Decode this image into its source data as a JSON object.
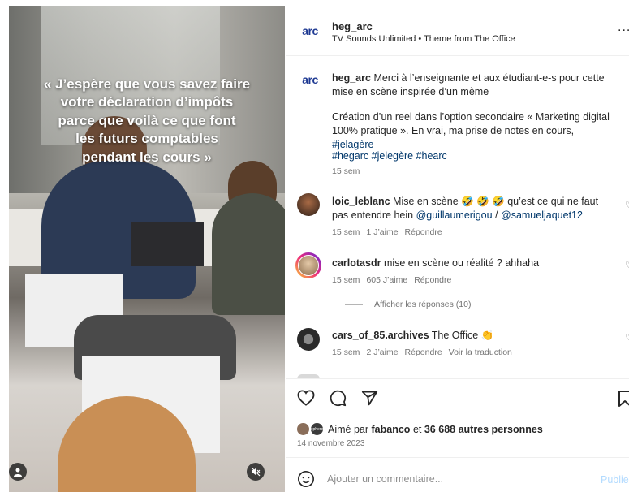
{
  "video": {
    "overlay_text": "« J’espère que vous savez faire\nvotre déclaration d’impôts\nparce que voilà ce que font\nles futurs comptables\npendant les cours »"
  },
  "header": {
    "logo_text": "arc",
    "username": "heg_arc",
    "audio": "TV Sounds Unlimited • Theme from The Office",
    "more_label": "..."
  },
  "caption": {
    "username": "heg_arc",
    "text1": "Merci à l’enseignante et aux étudiant-e-s pour cette mise en scène inspirée d’un mème",
    "text2": "Création d’un reel dans l’option secondaire « Marketing digital 100% pratique ». En vrai, ma prise de notes en cours,",
    "hashtag_inline": "#jelagère",
    "hashtags": "#hegarc #jelegère #hearc",
    "time": "15 sem"
  },
  "comments": [
    {
      "username": "loic_leblanc",
      "text": "Mise en scène 🤣 🤣 🤣 qu’est ce qui ne faut pas entendre hein",
      "mention1": "@guillaumerigou",
      "sep": " / ",
      "mention2": "@samueljaquet12",
      "time": "15 sem",
      "likes": "1 J’aime",
      "reply": "Répondre"
    },
    {
      "username": "carlotasdr",
      "text": "mise en scène ou réalité ? ahhaha",
      "time": "15 sem",
      "likes": "605 J’aime",
      "reply": "Répondre",
      "view_replies": "Afficher les réponses (10)"
    },
    {
      "username": "cars_of_85.archives",
      "text": "The Office 👏",
      "time": "15 sem",
      "likes": "2 J’aime",
      "reply": "Répondre",
      "translate": "Voir la traduction"
    }
  ],
  "likes": {
    "prefix": "Aimé par",
    "user": "fabanco",
    "and": "et",
    "others": "36 688 autres personnes",
    "avatar_text": "ephere"
  },
  "date": "14 novembre 2023",
  "comment_box": {
    "placeholder": "Ajouter un commentaire...",
    "publish": "Publie"
  },
  "colors": {
    "link": "#00376b",
    "brand": "#1f3a93",
    "meta": "#737373"
  }
}
